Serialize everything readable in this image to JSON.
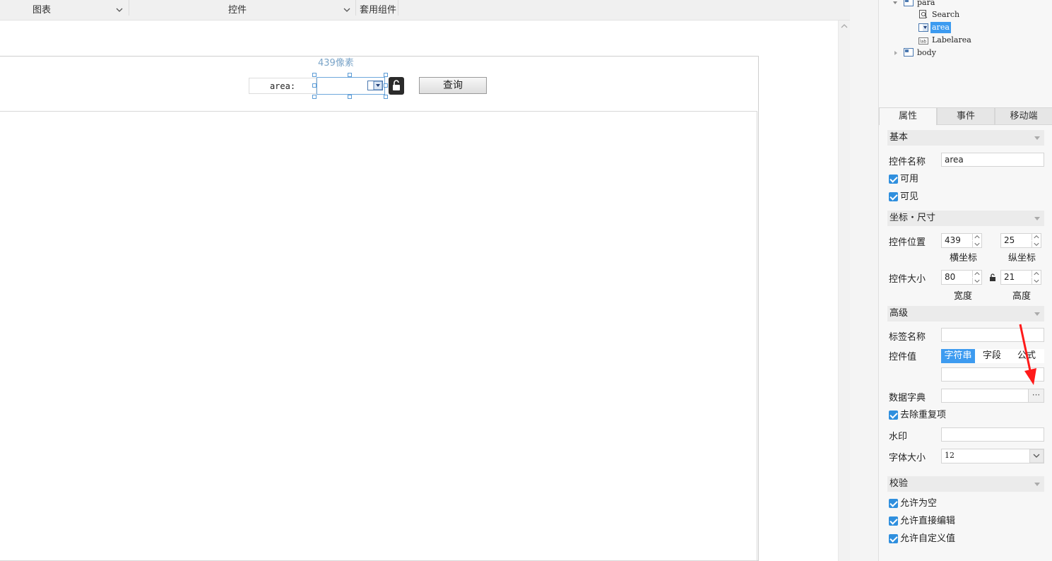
{
  "toolbar": {
    "chart_label": "图表",
    "widget_label": "控件",
    "template_label": "套用组件"
  },
  "canvas": {
    "pixel_label": "439像素",
    "area_label": "area:",
    "query_button": "查询"
  },
  "tree": {
    "items": [
      {
        "label": "para",
        "icon": "layout-icon"
      },
      {
        "label": "Search",
        "icon": "search-doc-icon"
      },
      {
        "label": "area",
        "icon": "dropdown-icon",
        "selected": true
      },
      {
        "label": "Labelarea",
        "icon": "label-icon"
      },
      {
        "label": "body",
        "icon": "layout-icon"
      }
    ]
  },
  "tabs": [
    "属性",
    "事件",
    "移动端"
  ],
  "props": {
    "section_basic": "基本",
    "name_label": "控件名称",
    "name_value": "area",
    "enabled_label": "可用",
    "visible_label": "可见",
    "section_coords": "坐标・尺寸",
    "position_label": "控件位置",
    "pos_x": "439",
    "pos_y": "25",
    "pos_x_label": "横坐标",
    "pos_y_label": "纵坐标",
    "size_label": "控件大小",
    "width": "80",
    "height": "21",
    "width_label": "宽度",
    "height_label": "高度",
    "section_advanced": "高级",
    "tag_name_label": "标签名称",
    "tag_name_value": "",
    "value_label": "控件值",
    "value_modes": [
      "字符串",
      "字段",
      "公式"
    ],
    "value_mode_selected": "字符串",
    "value_value": "",
    "dictionary_label": "数据字典",
    "dictionary_value": "",
    "dictionary_button": "···",
    "dedupe_label": "去除重复项",
    "watermark_label": "水印",
    "watermark_value": "",
    "font_size_label": "字体大小",
    "font_size_value": "12",
    "section_validate": "校验",
    "allow_empty_label": "允许为空",
    "allow_edit_label": "允许直接编辑",
    "allow_custom_label": "允许自定义值"
  },
  "colors": {
    "accent": "#3d9bf0",
    "selection": "#2f8fde",
    "annotation_arrow": "#ff1a1a"
  }
}
